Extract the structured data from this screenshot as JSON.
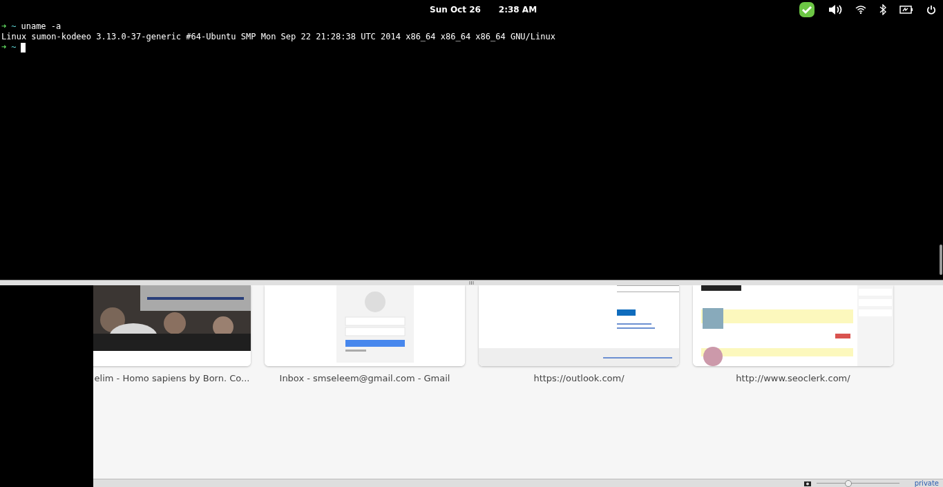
{
  "top_bar": {
    "date": "Sun Oct 26",
    "time": "2:38 AM"
  },
  "terminal": {
    "lines": [
      {
        "kind": "prompt",
        "arrow": "➜",
        "dir": "~",
        "command": "uname -a"
      },
      {
        "kind": "output",
        "text": "Linux sumon-kodeeo 3.13.0-37-generic #64-Ubuntu SMP Mon Sep 22 21:28:38 UTC 2014 x86_64 x86_64 x86_64 GNU/Linux"
      },
      {
        "kind": "prompt",
        "arrow": "➜",
        "dir": "~",
        "cursor": true
      }
    ]
  },
  "thumbnails": [
    {
      "title": "elim - Homo sapiens by Born. Co..."
    },
    {
      "title": "Inbox - smseleem@gmail.com - Gmail",
      "kind": "login"
    },
    {
      "title": "https://outlook.com/",
      "kind": "form"
    },
    {
      "title": "http://www.seoclerk.com/",
      "kind": "list"
    }
  ],
  "status_bar": {
    "zoom": {
      "level": 0.38
    },
    "label": "private"
  }
}
